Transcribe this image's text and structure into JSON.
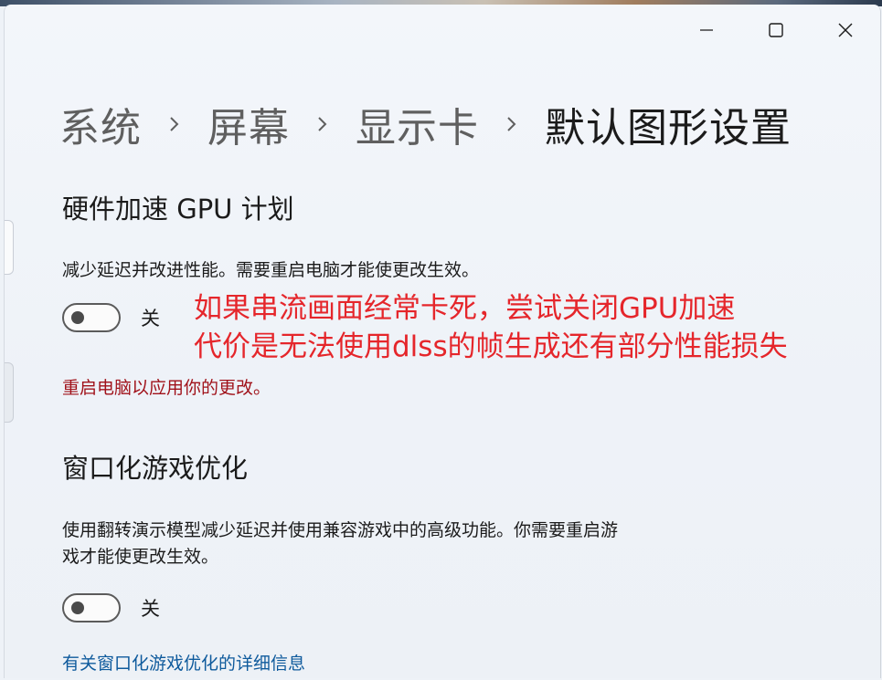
{
  "window": {
    "caption": {
      "minimize_icon": "minimize-icon",
      "maximize_icon": "maximize-icon",
      "close_icon": "close-icon"
    }
  },
  "breadcrumb": {
    "items": [
      "系统",
      "屏幕",
      "显示卡",
      "默认图形设置"
    ],
    "separator_icon": "chevron-right-icon"
  },
  "gpu_scheduling": {
    "title": "硬件加速 GPU 计划",
    "description": "减少延迟并改进性能。需要重启电脑才能使更改生效。",
    "toggle_state": "关",
    "toggle_on": false,
    "restart_note": "重启电脑以应用你的更改。"
  },
  "annotation": {
    "line1": "如果串流画面经常卡死，尝试关闭GPU加速",
    "line2": "代价是无法使用dlss的帧生成还有部分性能损失"
  },
  "windowed_games": {
    "title": "窗口化游戏优化",
    "description_line1": "使用翻转演示模型减少延迟并使用兼容游戏中的高级功能。你需要重启游",
    "description_line2": "戏才能使更改生效。",
    "toggle_state": "关",
    "toggle_on": false,
    "link": "有关窗口化游戏优化的详细信息"
  },
  "colors": {
    "accent_link": "#0e5a9c",
    "warning_text": "#a0121a",
    "annotation_red": "#e5262b"
  }
}
